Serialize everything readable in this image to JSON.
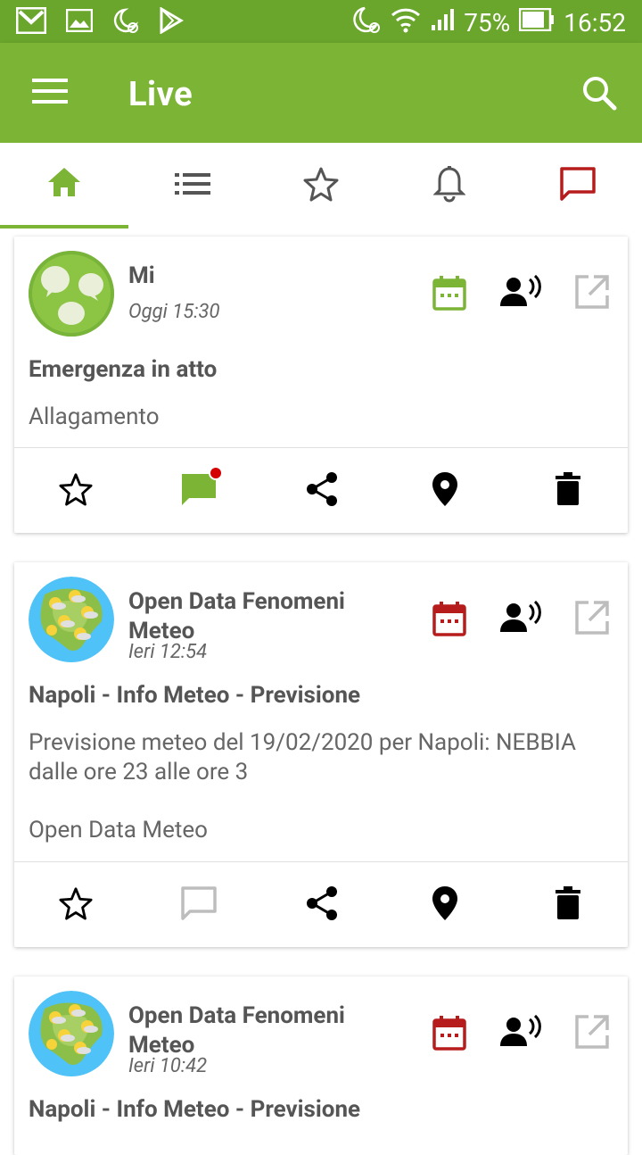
{
  "status_bar": {
    "battery": "75%",
    "time": "16:52"
  },
  "app_bar": {
    "title": "Live"
  },
  "tabs": [
    {
      "name": "home",
      "active": true
    },
    {
      "name": "list"
    },
    {
      "name": "favorites"
    },
    {
      "name": "notifications"
    },
    {
      "name": "messages"
    }
  ],
  "cards": [
    {
      "sender": "Mi",
      "time": "Oggi 15:30",
      "title": "Emergenza in atto",
      "body": "Allagamento",
      "source": "",
      "calendar_color": "#7cb436",
      "comment_badge": true
    },
    {
      "sender": "Open Data Fenomeni Meteo",
      "time": "Ieri 12:54",
      "title": "Napoli - Info Meteo - Previsione",
      "body": "Previsione meteo del 19/02/2020 per Napoli: NEBBIA dalle ore 23 alle ore 3",
      "source": "Open Data Meteo",
      "calendar_color": "#b71c1c",
      "comment_badge": false
    },
    {
      "sender": "Open Data Fenomeni Meteo",
      "time": "Ieri 10:42",
      "title": "Napoli - Info Meteo - Previsione",
      "calendar_color": "#b71c1c"
    }
  ],
  "colors": {
    "brand": "#7cb436",
    "status_bar": "#6aa52c",
    "alert_red": "#b71c1c"
  }
}
